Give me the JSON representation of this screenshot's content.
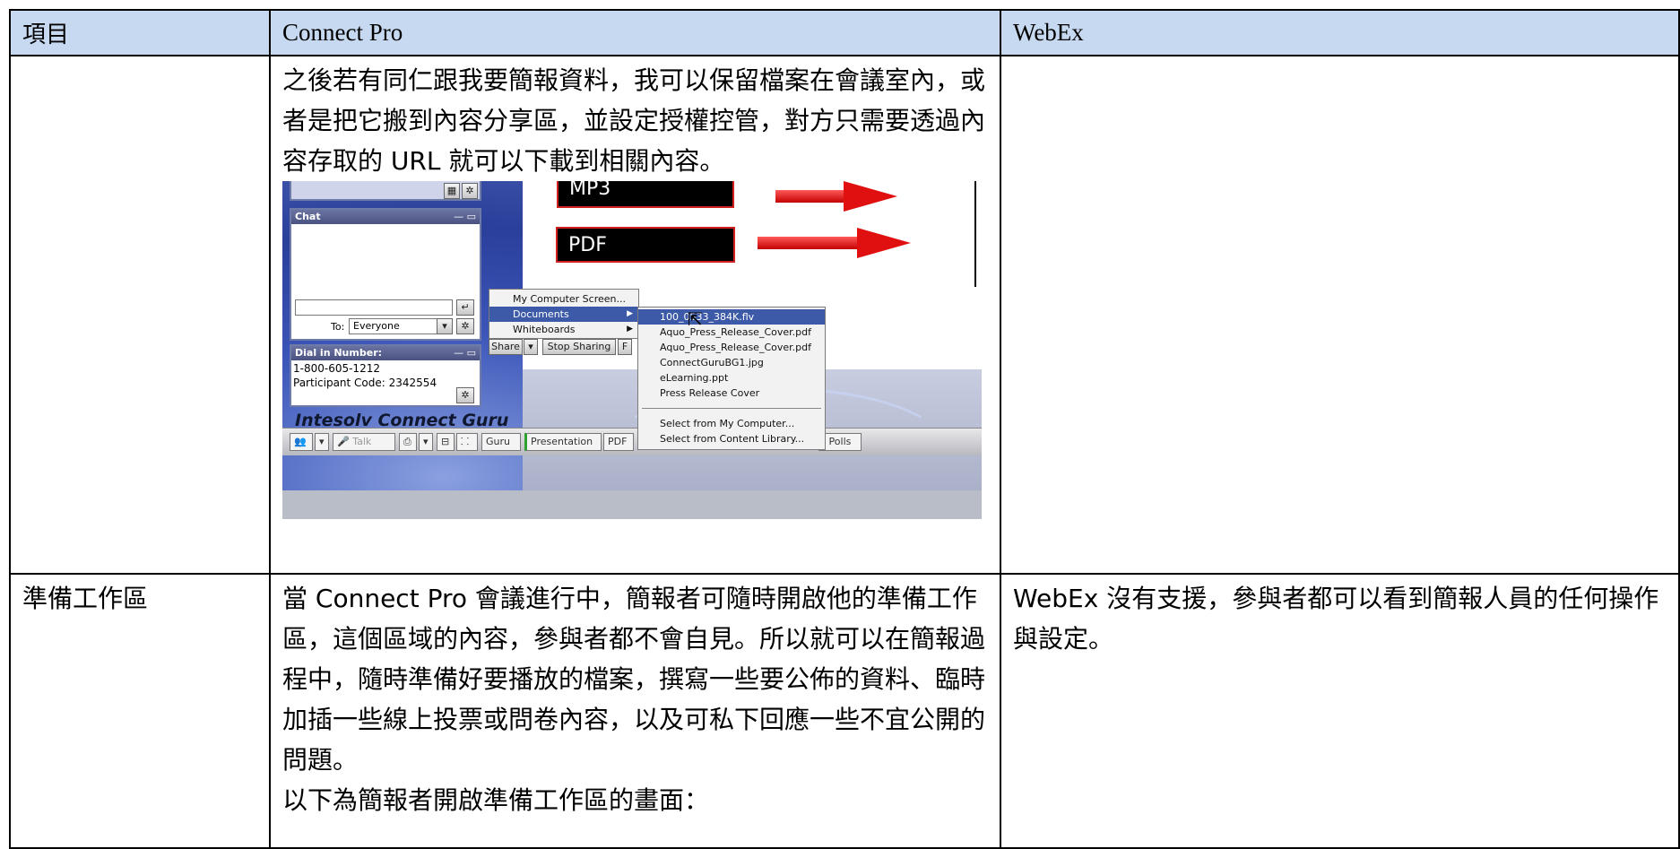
{
  "header": {
    "col1": "項目",
    "col2": "Connect Pro",
    "col3": "WebEx"
  },
  "row1": {
    "item": "",
    "connect_text": "之後若有同仁跟我要簡報資料，我可以保留檔案在會議室內，或者是把它搬到內容分享區，並設定授權控管，對方只需要透過內容存取的 URL 就可以下載到相關內容。",
    "webex_text": ""
  },
  "screenshot": {
    "mp3_label": "MP3",
    "pdf_label": "PDF",
    "chat_title": "Chat",
    "to_label": "To:",
    "to_value": "Everyone",
    "dial_title": "Dial in Number:",
    "dial_number": "1-800-605-1212",
    "participant_code": "Participant Code: 2342554",
    "brand": "Intesolv Connect Guru",
    "share_button": "Share",
    "stop_sharing_button": "Stop Sharing",
    "share_menu": [
      "My Computer Screen...",
      "Documents",
      "Whiteboards"
    ],
    "documents_menu": [
      "100_0533_384K.flv",
      "Aquo_Press_Release_Cover.pdf",
      "Aquo_Press_Release_Cover.pdf",
      "ConnectGuruBG1.jpg",
      "eLearning.ppt",
      "Press Release Cover"
    ],
    "documents_menu_extra": [
      "Select from My Computer...",
      "Select from Content Library..."
    ],
    "bottom_bar": [
      "Talk",
      "Guru",
      "Presentation",
      "PDF",
      "l Polls"
    ]
  },
  "row2": {
    "item": "準備工作區",
    "connect_text": "當 Connect Pro 會議進行中，簡報者可隨時開啟他的準備工作區，這個區域的內容，參與者都不會自見。所以就可以在簡報過程中，隨時準備好要播放的檔案，撰寫一些要公佈的資料、臨時加插一些線上投票或問卷內容，以及可私下回應一些不宜公開的問題。",
    "connect_text2": "以下為簡報者開啟準備工作區的畫面：",
    "webex_text": "WebEx 沒有支援，參與者都可以看到簡報人員的任何操作與設定。"
  }
}
